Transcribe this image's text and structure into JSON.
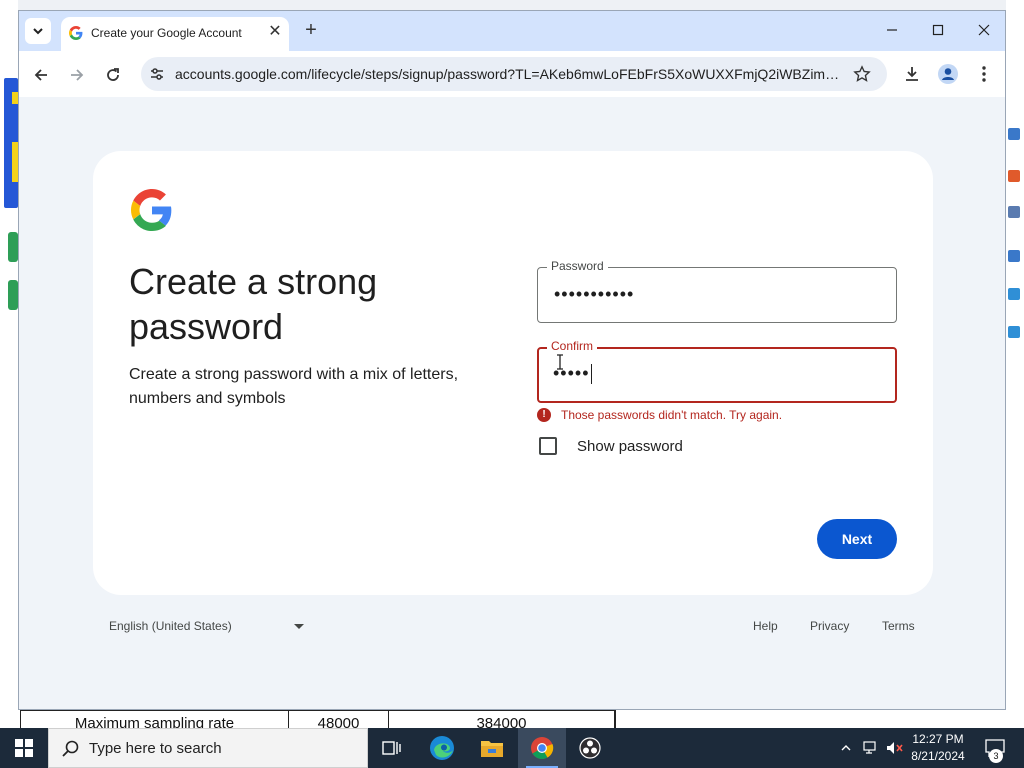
{
  "background": {
    "table_row": [
      "Maximum sampling rate",
      "48000",
      "384000"
    ]
  },
  "browser": {
    "tab": {
      "title": "Create your Google Account",
      "favicon": "google-g-icon"
    },
    "address_bar": {
      "url": "accounts.google.com/lifecycle/steps/signup/password?TL=AKeb6mwLoFEbFrS5XoWUXXFmjQ2iWBZimS4_..."
    },
    "icons": {
      "back": "back-arrow-icon",
      "forward": "forward-arrow-icon",
      "reload": "reload-icon",
      "site_settings": "tune-icon",
      "bookmark": "star-icon",
      "download": "download-icon",
      "profile": "profile-icon",
      "menu": "kebab-menu-icon"
    }
  },
  "signup": {
    "heading": "Create a strong password",
    "description": "Create a strong password with a mix of letters, numbers and symbols",
    "password_field": {
      "label": "Password",
      "value": "•••••••••••"
    },
    "confirm_field": {
      "label": "Confirm",
      "value": "•••••"
    },
    "error_message": "Those passwords didn't match. Try again.",
    "show_password": {
      "label": "Show password",
      "checked": false
    },
    "next_button": "Next"
  },
  "footer": {
    "language": "English (United States)",
    "links": [
      "Help",
      "Privacy",
      "Terms"
    ]
  },
  "taskbar": {
    "search_placeholder": "Type here to search",
    "time": "12:27 PM",
    "date": "8/21/2024",
    "notification_count": "3"
  },
  "colors": {
    "accent": "#0b57d0",
    "error": "#b3261e",
    "tabstrip": "#d3e3fd",
    "page_bg": "#f0f4f9"
  }
}
